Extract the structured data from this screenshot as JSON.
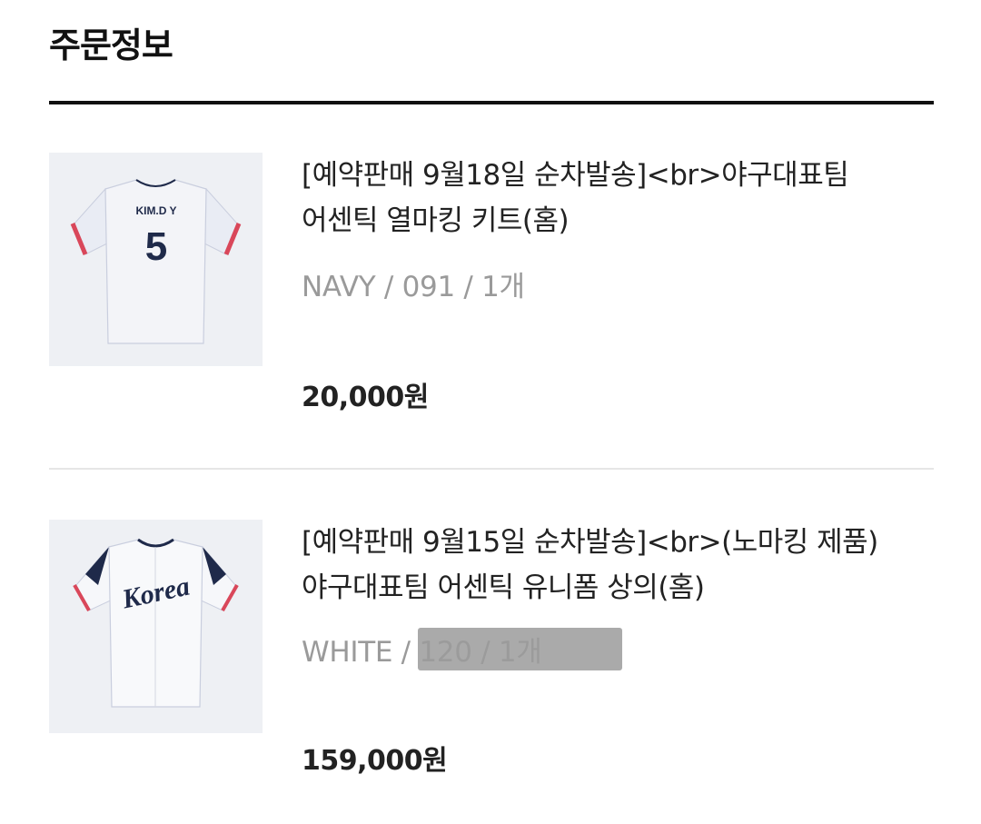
{
  "header": {
    "title": "주문정보"
  },
  "items": [
    {
      "name_line1": "[예약판매 9월18일 순차발송]<br>야구대표팀",
      "name_line2": "어센틱 열마킹 키트(홈)",
      "option": "NAVY / 091 / 1개",
      "price": "20,000원",
      "image": {
        "kind": "jersey-with-name-number",
        "jersey_text": "KIM.D Y",
        "jersey_number": "5"
      }
    },
    {
      "name_line1": "[예약판매 9월15일 순차발송]<br>(노마킹 제품)",
      "name_line2": "야구대표팀 어센틱 유니폼 상의(홈)",
      "option": "WHITE / 120 / 1개",
      "price": "159,000원",
      "image": {
        "kind": "korea-jersey",
        "jersey_text": "Korea"
      }
    }
  ],
  "colors": {
    "title_rule": "#111111",
    "option_text": "#9a9a9a",
    "redaction": "#9b9b9b",
    "jersey_navy": "#1f2a4a",
    "jersey_red": "#d9475a"
  }
}
